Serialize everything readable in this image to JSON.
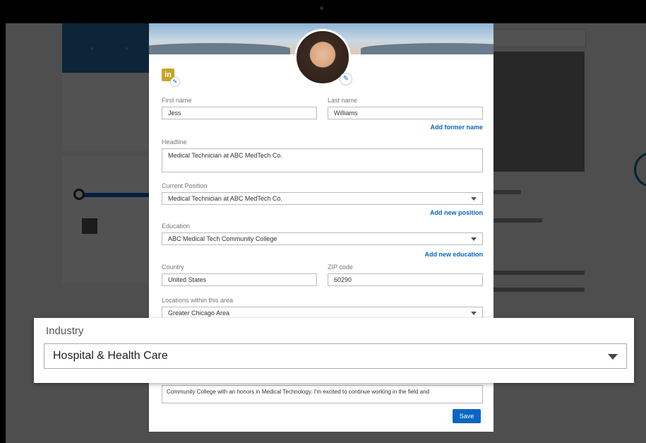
{
  "form": {
    "first_name_label": "First name",
    "first_name_value": "Jess",
    "last_name_label": "Last name",
    "last_name_value": "Williams",
    "add_former_name": "Add former name",
    "headline_label": "Headline",
    "headline_value": "Medical Technician at ABC MedTech Co.",
    "current_position_label": "Current Position",
    "current_position_value": "Medical Technician at ABC MedTech Co.",
    "add_new_position": "Add new position",
    "education_label": "Education",
    "education_value": "ABC Medical Tech Community College",
    "add_new_education": "Add new education",
    "country_label": "Country",
    "country_value": "United States",
    "zip_label": "ZIP code",
    "zip_value": "60290",
    "locations_label": "Locations within this area",
    "locations_value": "Greater Chicago Area",
    "summary_text": "Community College with an honors in Medical Technology. I'm excited to continue working in the field and",
    "save_label": "Save",
    "logo_text": "in"
  },
  "industry": {
    "label": "Industry",
    "value": "Hospital & Health Care"
  },
  "icons": {
    "edit_photo": "pencil-icon",
    "edit_logo": "pencil-icon",
    "dropdown": "chevron-down-icon"
  },
  "colors": {
    "accent": "#0a66c2",
    "overlay": "#000000"
  }
}
